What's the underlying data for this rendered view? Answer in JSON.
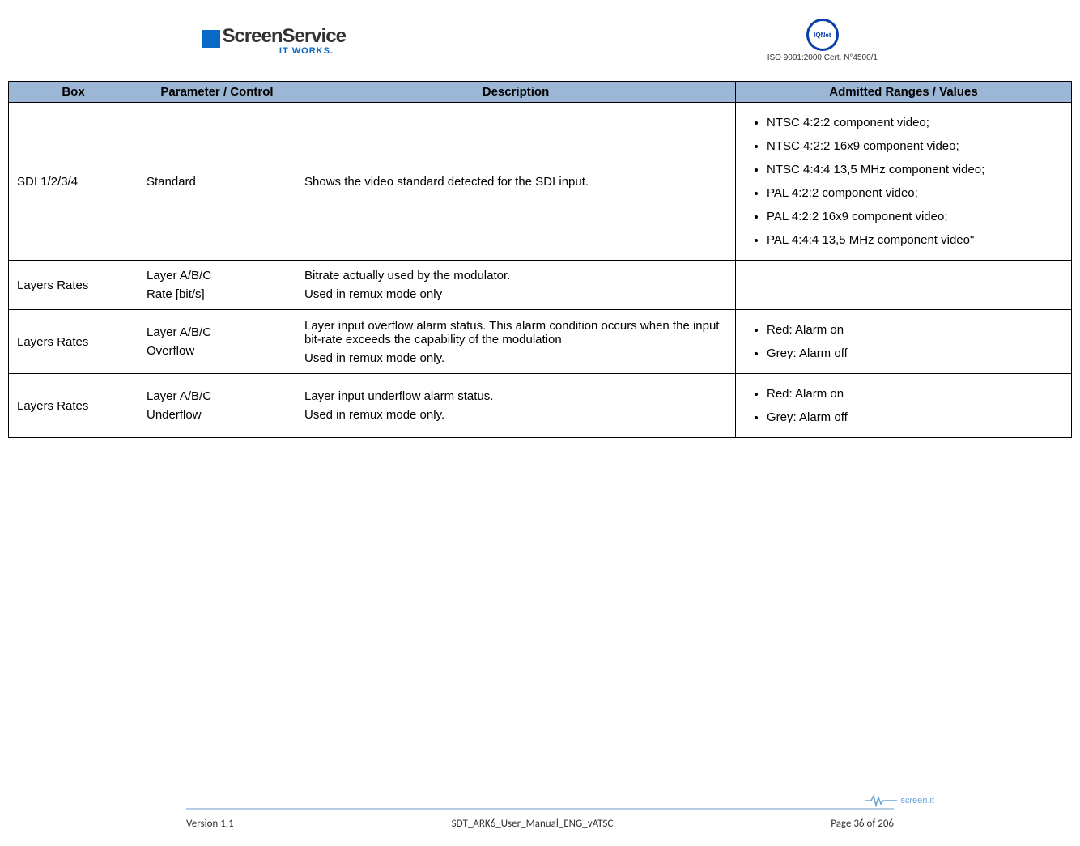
{
  "header": {
    "logo_main": "ScreenService",
    "logo_sub": "IT WORKS.",
    "iso_label": "IQNet",
    "iso_text": "ISO 9001:2000 Cert. N°4500/1"
  },
  "table": {
    "headers": {
      "box": "Box",
      "parameter": "Parameter / Control",
      "description": "Description",
      "values": "Admitted Ranges / Values"
    },
    "rows": [
      {
        "box": "SDI 1/2/3/4",
        "parameter": "Standard",
        "description": "Shows the video standard detected for the SDI input.",
        "values_list": [
          "NTSC 4:2:2 component video;",
          "NTSC 4:2:2 16x9 component video;",
          "NTSC 4:4:4 13,5 MHz component video;",
          "PAL 4:2:2 component video;",
          "PAL 4:2:2 16x9 component video;",
          "PAL 4:4:4 13,5 MHz component video\""
        ]
      },
      {
        "box": "Layers Rates",
        "parameter_lines": [
          "Layer A/B/C",
          "Rate [bit/s]"
        ],
        "description_lines": [
          "Bitrate actually used by the modulator.",
          "Used in remux mode only"
        ],
        "values_list": []
      },
      {
        "box": "Layers Rates",
        "parameter_lines": [
          "Layer A/B/C",
          "Overflow"
        ],
        "description_lines": [
          "Layer input overflow alarm status. This alarm condition occurs when the input bit-rate exceeds the capability of the modulation",
          "Used in remux mode only."
        ],
        "values_list": [
          "Red: Alarm on",
          "Grey: Alarm off"
        ]
      },
      {
        "box": "Layers Rates",
        "parameter_lines": [
          "Layer A/B/C",
          "Underflow"
        ],
        "description_lines": [
          "Layer input underflow alarm status.",
          "Used in remux mode only."
        ],
        "values_list": [
          "Red: Alarm on",
          "Grey: Alarm off"
        ]
      }
    ]
  },
  "footer": {
    "version": "Version 1.1",
    "doc": "SDT_ARK6_User_Manual_ENG_vATSC",
    "page": "Page 36 of 206",
    "brand": "screen.it"
  }
}
